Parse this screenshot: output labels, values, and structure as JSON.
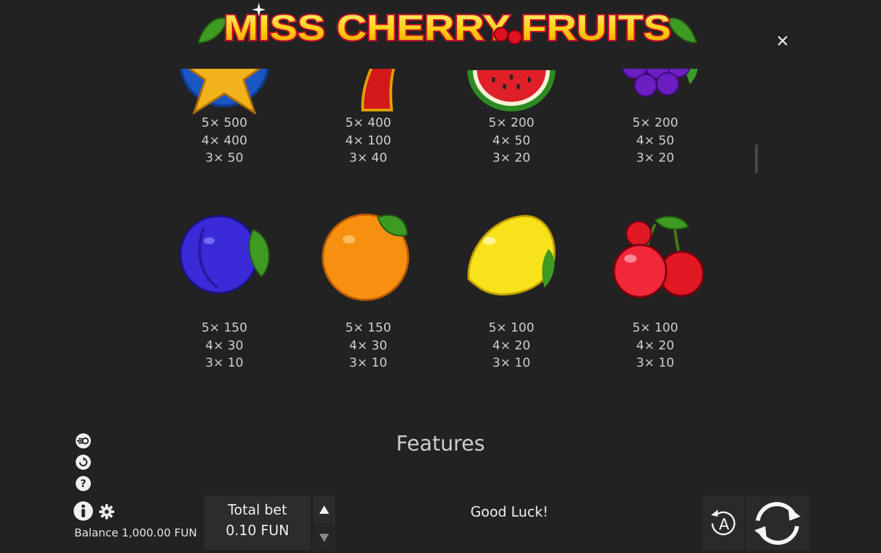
{
  "header": {
    "logo_text": "MISS CHERRY FRUITS",
    "close_icon": "close-icon"
  },
  "paytable": {
    "rows": [
      [
        {
          "symbol": "star",
          "payouts": [
            "5× 500",
            "4× 400",
            "3× 50"
          ]
        },
        {
          "symbol": "seven",
          "payouts": [
            "5× 400",
            "4× 100",
            "3× 40"
          ]
        },
        {
          "symbol": "watermelon",
          "payouts": [
            "5× 200",
            "4× 50",
            "3× 20"
          ]
        },
        {
          "symbol": "grapes",
          "payouts": [
            "5× 200",
            "4× 50",
            "3× 20"
          ]
        }
      ],
      [
        {
          "symbol": "plum",
          "payouts": [
            "5× 150",
            "4× 30",
            "3× 10"
          ]
        },
        {
          "symbol": "orange",
          "payouts": [
            "5× 150",
            "4× 30",
            "3× 10"
          ]
        },
        {
          "symbol": "lemon",
          "payouts": [
            "5× 100",
            "4× 20",
            "3× 10"
          ]
        },
        {
          "symbol": "cherry",
          "payouts": [
            "5× 100",
            "4× 20",
            "3× 10"
          ]
        }
      ]
    ]
  },
  "features_title": "Features",
  "side_icons": [
    "turbo-icon",
    "autoplay-history-icon",
    "help-icon"
  ],
  "footer": {
    "balance": "Balance 1,000.00 FUN",
    "bet_label": "Total bet",
    "bet_value": "0.10 FUN",
    "message": "Good Luck!",
    "auto_label": "A"
  },
  "colors": {
    "background": "#222222",
    "logo_yellow": "#ffd21c",
    "logo_red": "#d10f2c",
    "text": "#d6d6d6"
  }
}
